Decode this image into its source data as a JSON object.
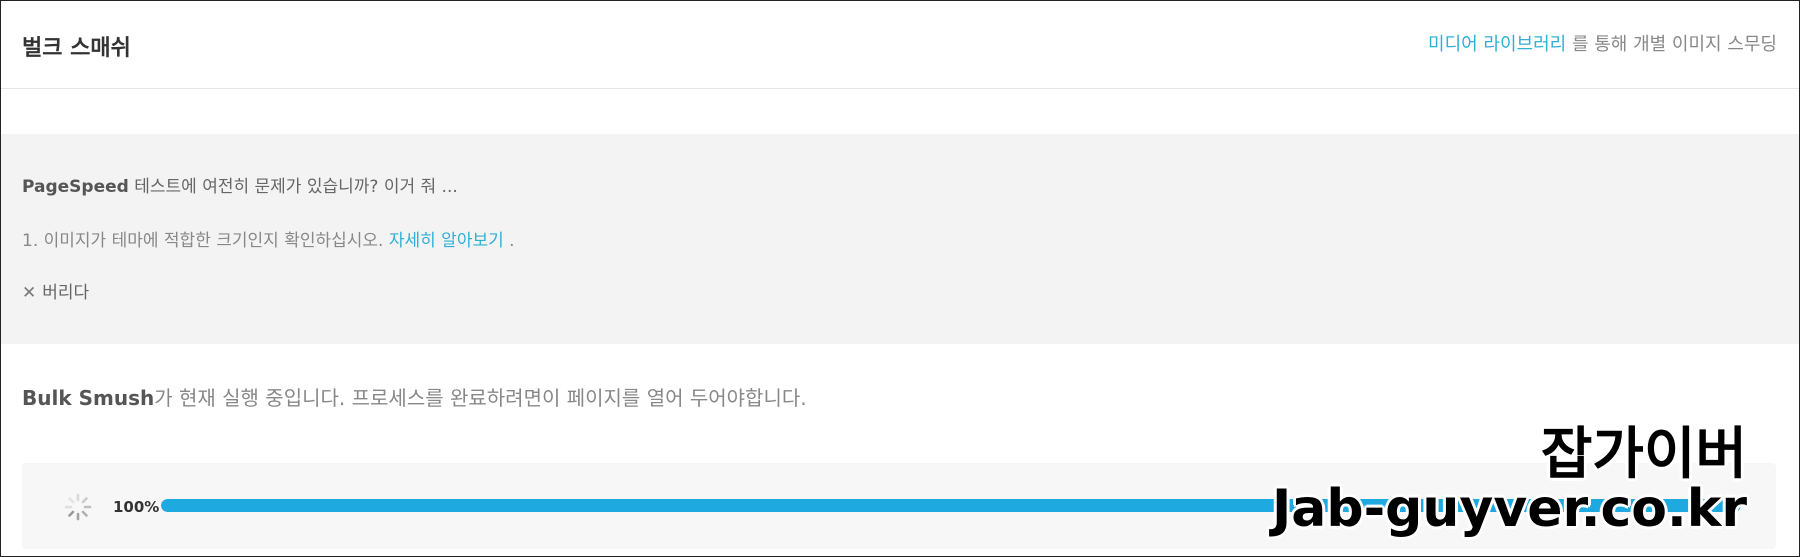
{
  "header": {
    "title": "벌크 스매쉬",
    "media_link": "미디어 라이브러리",
    "media_suffix": " 를 통해 개별 이미지 스무딩"
  },
  "notice": {
    "pagespeed_bold": "PageSpeed",
    "pagespeed_rest": " 테스트에 여전히 문제가 있습니까? 이거 줘 ...",
    "tip_text": "1. 이미지가 테마에 적합한 크기인지 확인하십시오. ",
    "learn_more": "자세히 알아보기",
    "tip_end": " .",
    "dismiss_label": "버리다"
  },
  "status": {
    "bold": "Bulk Smush",
    "rest": "가 현재 실행 중입니다. 프로세스를 완료하려면이 페이지를 열어 두어야합니다."
  },
  "progress": {
    "percent_label": "100%",
    "fraction": 1.0
  },
  "watermark": {
    "line1": "잡가이버",
    "line2": "Jab-guyver.co.kr"
  },
  "colors": {
    "accent": "#2fb0d6",
    "progress_fill": "#1fa9e1"
  },
  "icons": {
    "spinner": "loading-spinner-icon",
    "dismiss": "close-icon"
  }
}
